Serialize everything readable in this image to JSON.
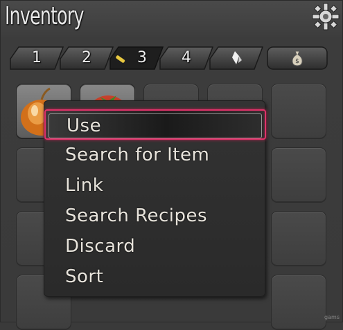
{
  "window": {
    "title": "Inventory"
  },
  "tabs": [
    {
      "label": "1",
      "icon": null,
      "active": false
    },
    {
      "label": "2",
      "icon": null,
      "active": false
    },
    {
      "label": "3",
      "icon": "key-icon",
      "active": true
    },
    {
      "label": "4",
      "icon": null,
      "active": false
    },
    {
      "label": "",
      "icon": "crystal-icon",
      "active": false
    },
    {
      "label": "",
      "icon": "money-bag-icon",
      "active": false
    }
  ],
  "slots": [
    {
      "item": "onion-icon"
    },
    {
      "item": "tomato-icon"
    }
  ],
  "context_menu": {
    "items": [
      {
        "label": "Use",
        "selected": true
      },
      {
        "label": "Search for Item",
        "selected": false
      },
      {
        "label": "Link",
        "selected": false
      },
      {
        "label": "Search Recipes",
        "selected": false
      },
      {
        "label": "Discard",
        "selected": false
      },
      {
        "label": "Sort",
        "selected": false
      }
    ]
  },
  "watermark": "gams",
  "colors": {
    "selection_border": "#e0336a",
    "text": "#e8e4dc",
    "panel": "#3a3a3a"
  }
}
